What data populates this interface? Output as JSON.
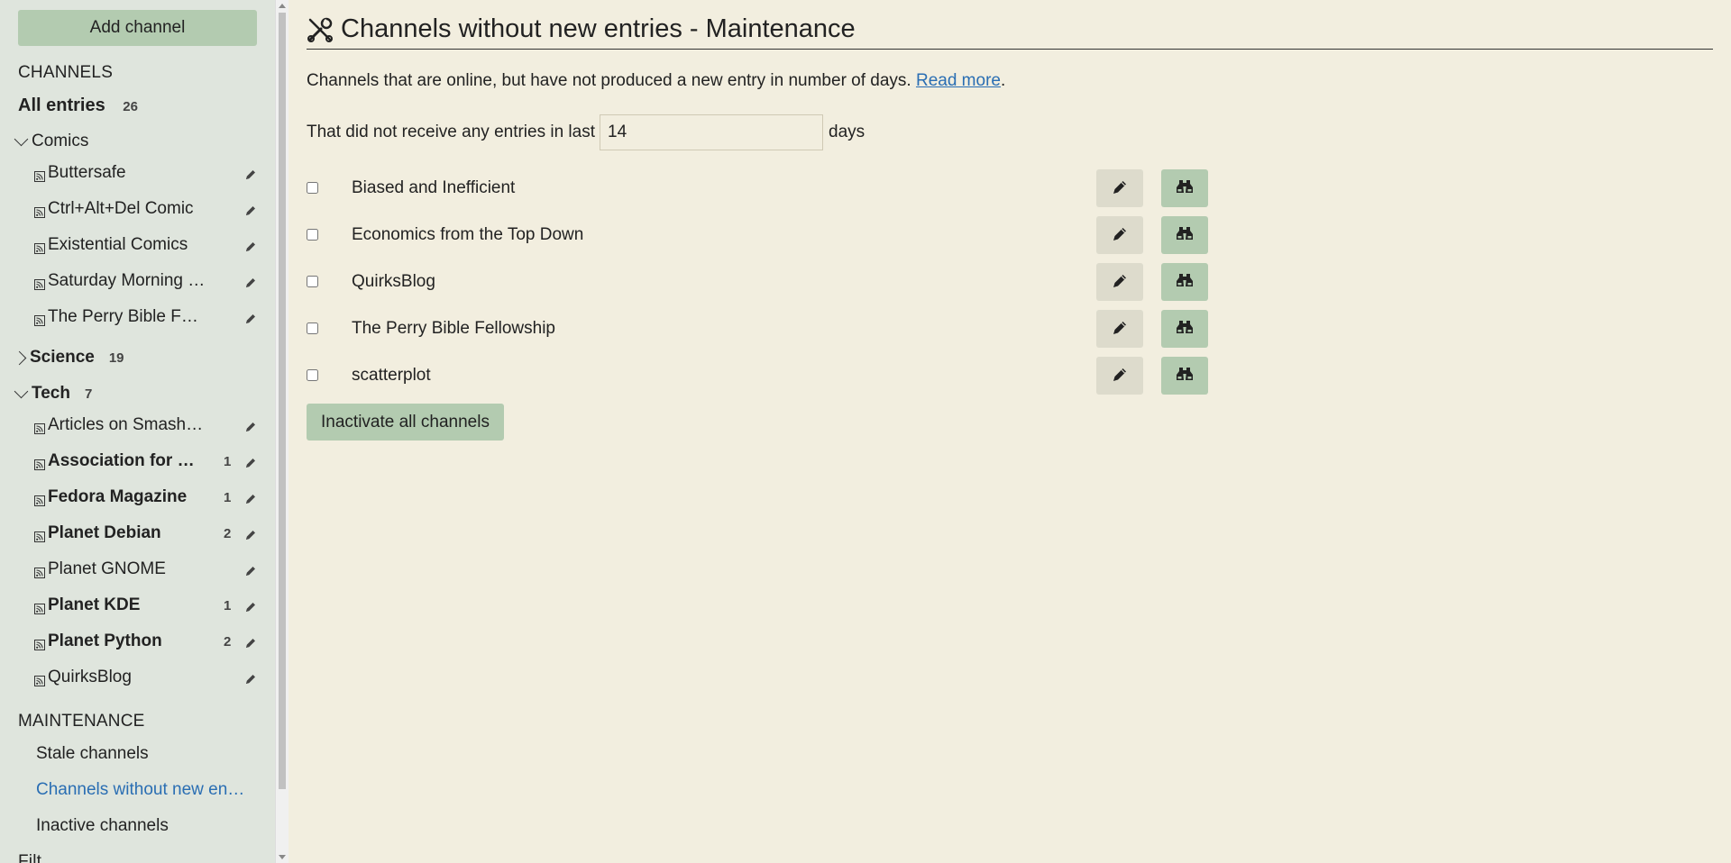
{
  "sidebar": {
    "add_channel": "Add channel",
    "channels_heading": "CHANNELS",
    "all_entries": {
      "label": "All entries",
      "count": "26"
    },
    "folders": [
      {
        "name": "Comics",
        "count": "",
        "expanded": true,
        "feeds": [
          {
            "label": "Buttersafe",
            "count": "",
            "unread": false
          },
          {
            "label": "Ctrl+Alt+Del Comic",
            "count": "",
            "unread": false
          },
          {
            "label": "Existential Comics",
            "count": "",
            "unread": false
          },
          {
            "label": "Saturday Morning …",
            "count": "",
            "unread": false
          },
          {
            "label": "The Perry Bible F…",
            "count": "",
            "unread": false
          }
        ]
      },
      {
        "name": "Science",
        "count": "19",
        "expanded": false,
        "feeds": []
      },
      {
        "name": "Tech",
        "count": "7",
        "expanded": true,
        "feeds": [
          {
            "label": "Articles on Smash…",
            "count": "",
            "unread": false
          },
          {
            "label": "Association for …",
            "count": "1",
            "unread": true
          },
          {
            "label": "Fedora Magazine",
            "count": "1",
            "unread": true
          },
          {
            "label": "Planet Debian",
            "count": "2",
            "unread": true
          },
          {
            "label": "Planet GNOME",
            "count": "",
            "unread": false
          },
          {
            "label": "Planet KDE",
            "count": "1",
            "unread": true
          },
          {
            "label": "Planet Python",
            "count": "2",
            "unread": true
          },
          {
            "label": "QuirksBlog",
            "count": "",
            "unread": false
          }
        ]
      }
    ],
    "maintenance_heading": "MAINTENANCE",
    "maintenance_items": [
      {
        "label": "Stale channels",
        "active": false
      },
      {
        "label": "Channels without new en…",
        "active": true
      },
      {
        "label": "Inactive channels",
        "active": false
      }
    ],
    "filters_heading": "Filt"
  },
  "main": {
    "title": "Channels without new entries - Maintenance",
    "description": "Channels that are online, but have not produced a new entry in number of days. ",
    "read_more": "Read more",
    "period": ".",
    "days_prefix": "That did not receive any entries in last",
    "days_value": "14",
    "days_suffix": "days",
    "channels": [
      "Biased and Inefficient",
      "Economics from the Top Down",
      "QuirksBlog",
      "The Perry Bible Fellowship",
      "scatterplot"
    ],
    "inactivate_all": "Inactivate all channels"
  },
  "colors": {
    "background": "#f2eedf",
    "sidebar": "#dfe5dd",
    "accent_green": "#b3cbb0",
    "link": "#2a6eb3"
  }
}
